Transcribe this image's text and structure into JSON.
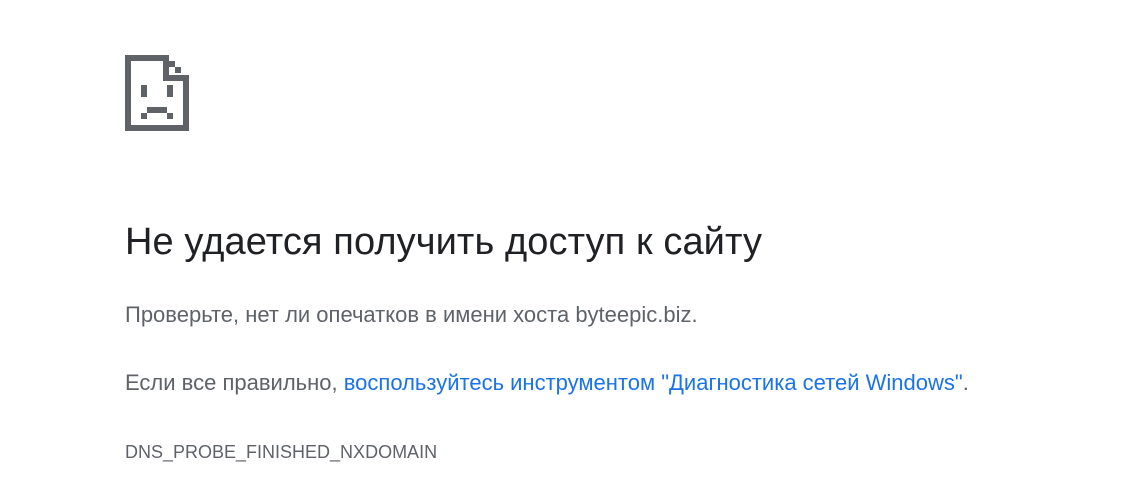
{
  "icon": "sad-page-icon",
  "colors": {
    "title": "#202124",
    "text": "#5f6368",
    "link": "#1a73e8",
    "icon": "#5f6368"
  },
  "error": {
    "title": "Не удается получить доступ к сайту",
    "hint": "Проверьте, нет ли опечатков в имени хоста byteepic.biz.",
    "suggestion_prefix": "Если все правильно, ",
    "suggestion_link": "воспользуйтесь инструментом \"Диагностика сетей Windows\"",
    "suggestion_suffix": ".",
    "code": "DNS_PROBE_FINISHED_NXDOMAIN"
  }
}
